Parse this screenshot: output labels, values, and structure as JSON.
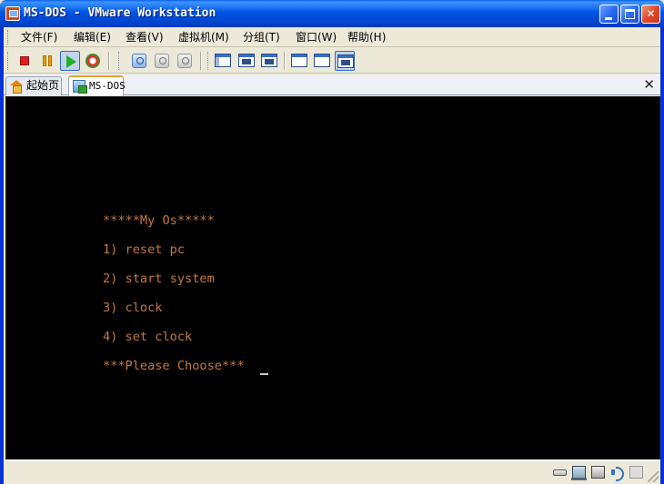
{
  "window": {
    "title": "MS-DOS - VMware Workstation"
  },
  "menu": {
    "items": [
      "文件(F)",
      "编辑(E)",
      "查看(V)",
      "虚拟机(M)",
      "分组(T)",
      "窗口(W)",
      "帮助(H)"
    ]
  },
  "toolbar": {
    "icons": [
      "stop-icon",
      "pause-icon",
      "play-icon",
      "reset-icon",
      "snapshot-icon",
      "revert-snapshot-icon",
      "snapshot-manager-icon",
      "sidebar-view-icon",
      "full-screen-icon",
      "quick-switch-icon",
      "console-view-icon",
      "summary-view-icon",
      "unity-view-icon"
    ]
  },
  "tabs": {
    "home_label": "起始页",
    "active_label": "MS-DOS",
    "close_glyph": "✕"
  },
  "console": {
    "lines": [
      "*****My Os*****",
      "1) reset pc",
      "2) start system",
      "3) clock",
      "4) set clock",
      "***Please Choose***"
    ],
    "text_color": "#c77a3c",
    "background": "#000000"
  },
  "statusbar": {
    "icons": [
      "hard-disk-icon",
      "network-icon",
      "printer-icon",
      "sound-icon",
      "message-icon"
    ]
  },
  "colors": {
    "title_blue": "#0055e5",
    "face": "#ece9d8",
    "close_red": "#e0482a"
  }
}
